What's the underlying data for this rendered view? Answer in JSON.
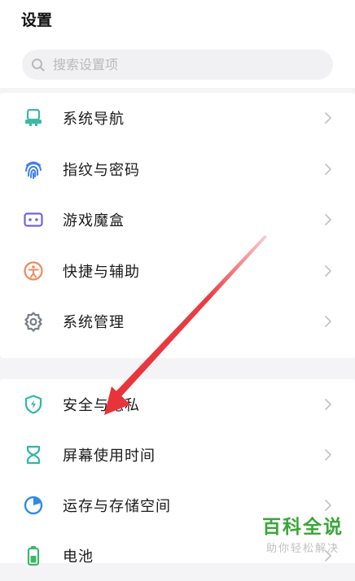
{
  "header": {
    "title": "设置"
  },
  "search": {
    "placeholder": "搜索设置项",
    "icon": "search-icon"
  },
  "groups": [
    {
      "items": [
        {
          "label": "系统导航",
          "icon": "system-navigation-icon",
          "color": "#3db8a3"
        },
        {
          "label": "指纹与密码",
          "icon": "fingerprint-icon",
          "color": "#3d7ef0"
        },
        {
          "label": "游戏魔盒",
          "icon": "game-box-icon",
          "color": "#6f66d8"
        },
        {
          "label": "快捷与辅助",
          "icon": "accessibility-icon",
          "color": "#ef8a5a"
        },
        {
          "label": "系统管理",
          "icon": "gear-icon",
          "color": "#777c86"
        }
      ]
    },
    {
      "items": [
        {
          "label": "安全与隐私",
          "icon": "shield-icon",
          "color": "#2fb8a8"
        },
        {
          "label": "屏幕使用时间",
          "icon": "hourglass-icon",
          "color": "#2fb8a8"
        },
        {
          "label": "运存与存储空间",
          "icon": "pie-chart-icon",
          "color": "#2e8be6"
        },
        {
          "label": "电池",
          "icon": "battery-icon",
          "color": "#3db86a"
        }
      ]
    }
  ],
  "annotation": {
    "type": "red-arrow",
    "color": "#e8333a"
  },
  "watermark": {
    "title": "百科全说",
    "subtitle": "助你轻松解决"
  }
}
